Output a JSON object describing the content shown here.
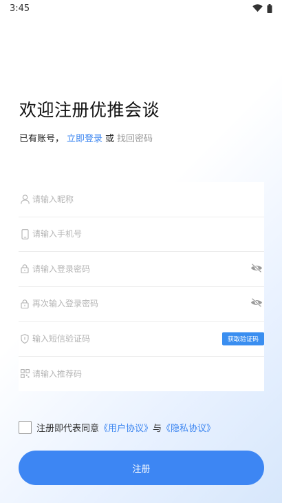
{
  "status_bar": {
    "time": "3:45",
    "icons": [
      "wifi-icon",
      "battery-icon"
    ]
  },
  "header": {
    "title": "欢迎注册优推会谈",
    "prompt": "已有账号，",
    "login_link": "立即登录",
    "or_text": "或",
    "find_password_link": "找回密码"
  },
  "form": {
    "nickname_placeholder": "请输入昵称",
    "phone_placeholder": "请输入手机号",
    "password_placeholder": "请输入登录密码",
    "confirm_password_placeholder": "再次输入登录密码",
    "sms_code_placeholder": "输入短信验证码",
    "sms_button": "获取验证码",
    "referral_placeholder": "请输入推荐码"
  },
  "agreement": {
    "prefix": "注册即代表同意",
    "user_agreement": "《用户协议》",
    "and_text": "与",
    "privacy_agreement": "《隐私协议》"
  },
  "register_button": "注册",
  "colors": {
    "accent": "#3d86f3",
    "link": "#3a84f0",
    "placeholder": "#b5b5b5"
  }
}
